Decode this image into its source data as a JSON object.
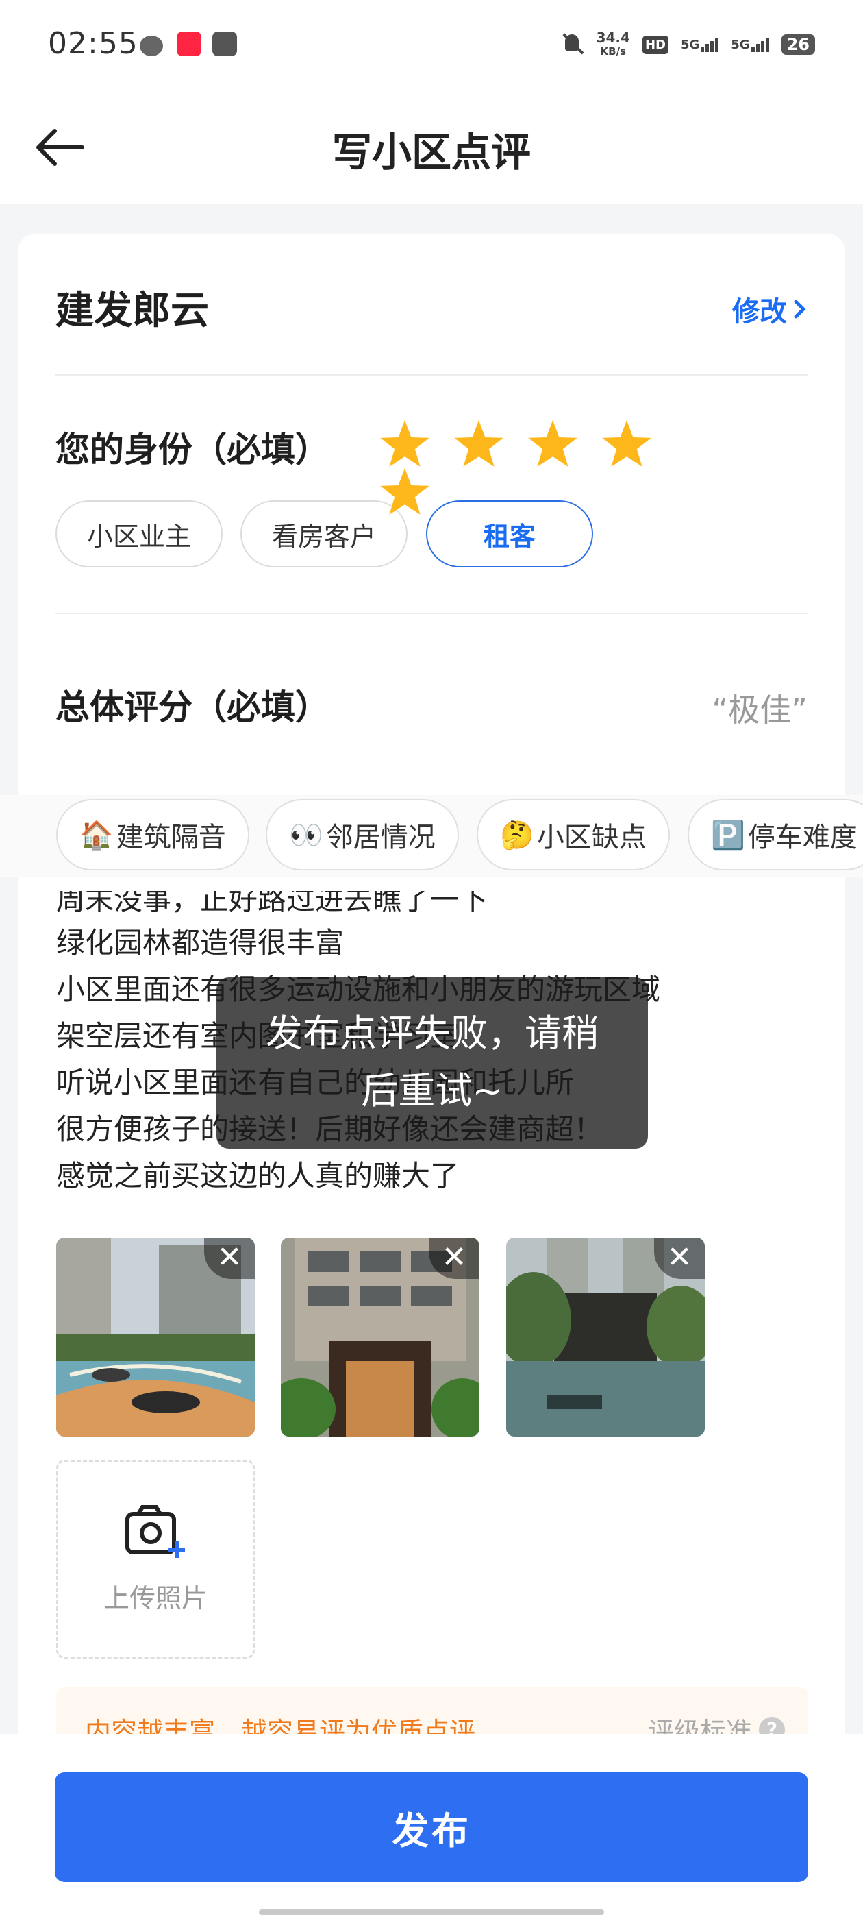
{
  "status_bar": {
    "time": "02:55",
    "net_speed_value": "34.4",
    "net_speed_unit": "KB/s",
    "hd_label": "HD",
    "sim1": "5G",
    "sim2": "5G",
    "battery": "26"
  },
  "nav": {
    "title": "写小区点评"
  },
  "community": {
    "name": "建发郎云",
    "edit_label": "修改"
  },
  "identity": {
    "title": "您的身份（必填）",
    "options": [
      "小区业主",
      "看房客户",
      "租客"
    ],
    "selected": "租客"
  },
  "rating": {
    "title": "总体评分（必填）",
    "stars": 5,
    "max_stars": 5,
    "word": "“极佳”",
    "star_color": "#fdb71a"
  },
  "topic_tags": [
    {
      "emoji": "🏠",
      "label": "建筑隔音"
    },
    {
      "emoji": "👀",
      "label": "邻居情况"
    },
    {
      "emoji": "🤔",
      "label": "小区缺点"
    },
    {
      "emoji": "🅿️",
      "label": "停车难度"
    }
  ],
  "review": {
    "lines": [
      "周末没事，正好路过进去瞧了一下",
      "绿化园林都造得很丰富",
      "小区里面还有很多运动设施和小朋友的游玩区域",
      "架空层还有室内图书室和学习室",
      "听说小区里面还有自己的幼儿园和托儿所",
      "很方便孩子的接送！后期好像还会建商超！",
      "感觉之前买这边的人真的赚大了"
    ]
  },
  "photos": {
    "remove_symbol": "✕",
    "upload_label": "上传照片"
  },
  "tip": {
    "text": "内容越丰富，越容易评为优质点评",
    "link": "评级标准",
    "help_symbol": "?"
  },
  "publish_label": "发布",
  "toast": {
    "line1": "发布点评失败，请稍",
    "line2": "后重试~"
  },
  "colors": {
    "accent": "#2e6ff2",
    "link": "#1a6cf2",
    "tip_text": "#f07a1c"
  }
}
